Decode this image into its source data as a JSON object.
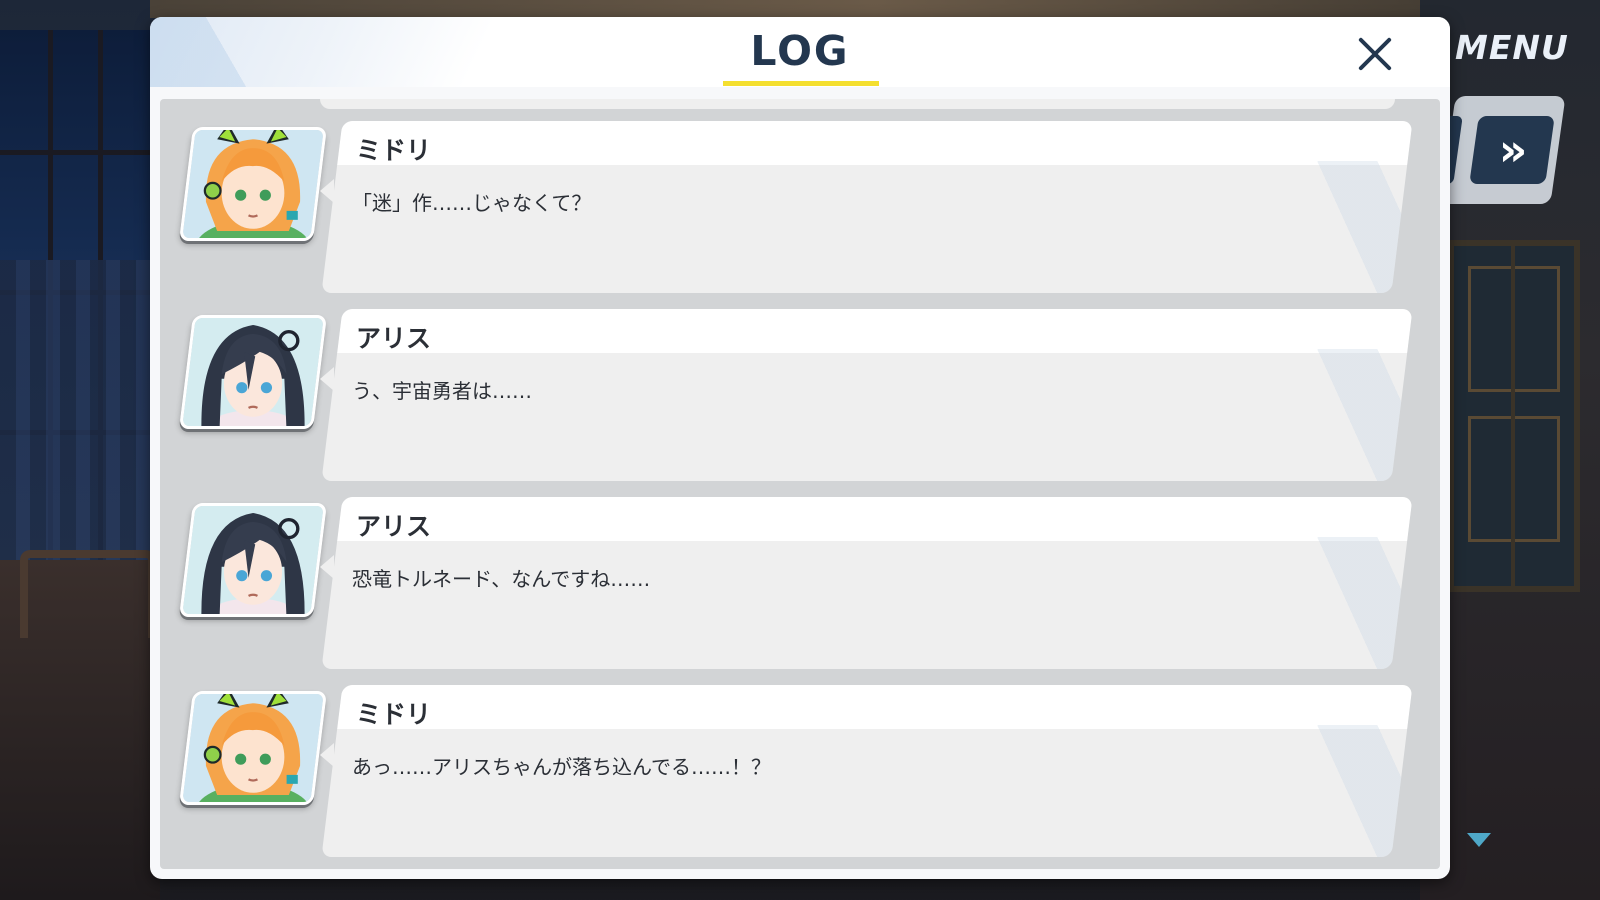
{
  "dialog": {
    "title": "LOG",
    "close_icon": "close-icon"
  },
  "hud": {
    "menu_label": "MENU",
    "skip_icon": "fast-forward-icon",
    "skip_glyph": "»"
  },
  "log": {
    "entries": [
      {
        "speaker": "ミドリ",
        "text": "「迷」作……じゃなくて？",
        "portrait": "midori-portrait"
      },
      {
        "speaker": "アリス",
        "text": "う、宇宙勇者は……",
        "portrait": "alice-portrait"
      },
      {
        "speaker": "アリス",
        "text": "恐竜トルネード、なんですね……",
        "portrait": "alice-portrait"
      },
      {
        "speaker": "ミドリ",
        "text": "あっ……アリスちゃんが落ち込んでる……！？",
        "portrait": "midori-portrait"
      }
    ]
  },
  "colors": {
    "accent_navy": "#23374f",
    "title_underline": "#f4df2f",
    "bubble_bg": "#efefef",
    "name_bar_bg": "#ffffff",
    "scroll_indicator": "#4fa8c8"
  }
}
